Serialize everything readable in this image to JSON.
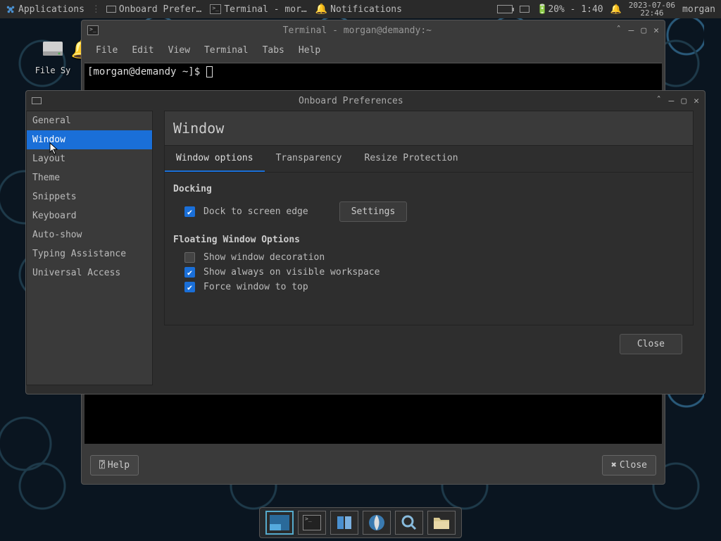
{
  "top_panel": {
    "apps_label": "Applications",
    "tasks": [
      {
        "icon": "kb",
        "label": "Onboard Prefer…"
      },
      {
        "icon": "term",
        "label": "Terminal - mor…"
      },
      {
        "icon": "bell",
        "label": "Notifications"
      }
    ],
    "battery": "20% - 1:40",
    "date": "2023-07-06",
    "time": "22:46",
    "user": "morgan"
  },
  "desktop": {
    "file_system_label": "File Sy"
  },
  "terminal": {
    "title": "Terminal - morgan@demandy:~",
    "menus": [
      "File",
      "Edit",
      "View",
      "Terminal",
      "Tabs",
      "Help"
    ],
    "prompt": "[morgan@demandy ~]$ ",
    "help_btn": "Help",
    "close_btn": "Close"
  },
  "onboard": {
    "title": "Onboard Preferences",
    "sidebar": [
      "General",
      "Window",
      "Layout",
      "Theme",
      "Snippets",
      "Keyboard",
      "Auto-show",
      "Typing Assistance",
      "Universal Access"
    ],
    "selected_sidebar": 1,
    "page_title": "Window",
    "tabs": [
      "Window options",
      "Transparency",
      "Resize Protection"
    ],
    "active_tab": 0,
    "section_docking": "Docking",
    "dock_to_edge": "Dock to screen edge",
    "settings_btn": "Settings",
    "section_floating": "Floating Window Options",
    "show_decoration": "Show window decoration",
    "show_always": "Show always on visible workspace",
    "force_top": "Force window to top",
    "close_btn": "Close"
  },
  "dock": {
    "items": [
      "desktop",
      "terminal",
      "files",
      "web",
      "search",
      "folder"
    ]
  }
}
